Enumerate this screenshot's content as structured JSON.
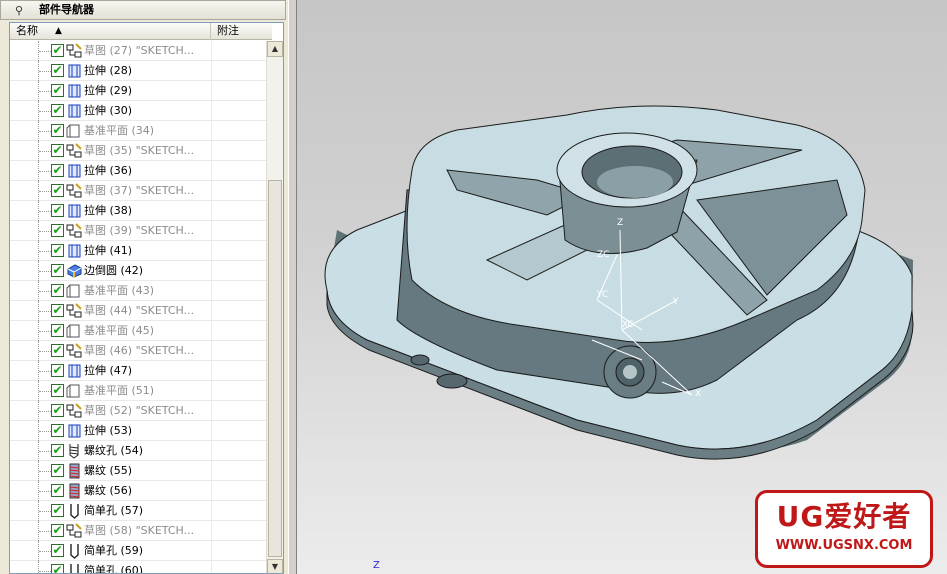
{
  "navigator": {
    "title": "部件导航器",
    "columns": {
      "name": "名称",
      "note": "附注"
    },
    "items": [
      {
        "icon": "sketch-icon",
        "label": "草图 (27) \"SKETCH...",
        "dim": true
      },
      {
        "icon": "extrude-icon",
        "label": "拉伸 (28)",
        "dim": false
      },
      {
        "icon": "extrude-icon",
        "label": "拉伸 (29)",
        "dim": false
      },
      {
        "icon": "extrude-icon",
        "label": "拉伸 (30)",
        "dim": false
      },
      {
        "icon": "datum-plane-icon",
        "label": "基准平面 (34)",
        "dim": true
      },
      {
        "icon": "sketch-icon",
        "label": "草图 (35) \"SKETCH...",
        "dim": true
      },
      {
        "icon": "extrude-icon",
        "label": "拉伸 (36)",
        "dim": false
      },
      {
        "icon": "sketch-icon",
        "label": "草图 (37) \"SKETCH...",
        "dim": true
      },
      {
        "icon": "extrude-icon",
        "label": "拉伸 (38)",
        "dim": false
      },
      {
        "icon": "sketch-icon",
        "label": "草图 (39) \"SKETCH...",
        "dim": true
      },
      {
        "icon": "extrude-icon",
        "label": "拉伸 (41)",
        "dim": false
      },
      {
        "icon": "edge-blend-icon",
        "label": "边倒圆 (42)",
        "dim": false
      },
      {
        "icon": "datum-plane-icon",
        "label": "基准平面 (43)",
        "dim": true
      },
      {
        "icon": "sketch-icon",
        "label": "草图 (44) \"SKETCH...",
        "dim": true
      },
      {
        "icon": "datum-plane-icon",
        "label": "基准平面 (45)",
        "dim": true
      },
      {
        "icon": "sketch-icon",
        "label": "草图 (46) \"SKETCH...",
        "dim": true
      },
      {
        "icon": "extrude-icon",
        "label": "拉伸 (47)",
        "dim": false
      },
      {
        "icon": "datum-plane-icon",
        "label": "基准平面 (51)",
        "dim": true
      },
      {
        "icon": "sketch-icon",
        "label": "草图 (52) \"SKETCH...",
        "dim": true
      },
      {
        "icon": "extrude-icon",
        "label": "拉伸 (53)",
        "dim": false
      },
      {
        "icon": "threaded-hole-icon",
        "label": "螺纹孔 (54)",
        "dim": false
      },
      {
        "icon": "thread-icon",
        "label": "螺纹 (55)",
        "dim": false
      },
      {
        "icon": "thread-icon",
        "label": "螺纹 (56)",
        "dim": false
      },
      {
        "icon": "simple-hole-icon",
        "label": "简单孔 (57)",
        "dim": false
      },
      {
        "icon": "sketch-icon",
        "label": "草图 (58) \"SKETCH...",
        "dim": true
      },
      {
        "icon": "simple-hole-icon",
        "label": "简单孔 (59)",
        "dim": false
      },
      {
        "icon": "simple-hole-icon",
        "label": "简单孔 (60)",
        "dim": false
      }
    ]
  },
  "viewport": {
    "axis_labels": {
      "z": "Z",
      "y": "Y",
      "x": "X",
      "xc": "XC",
      "yc": "YC",
      "zc": "ZC"
    },
    "corner_label": "Z",
    "model_color": "#c8dde3",
    "model_shade": "#5e7076"
  },
  "watermark": {
    "title": "UG爱好者",
    "url": "WWW.UGSNX.COM",
    "color": "#c01818"
  }
}
